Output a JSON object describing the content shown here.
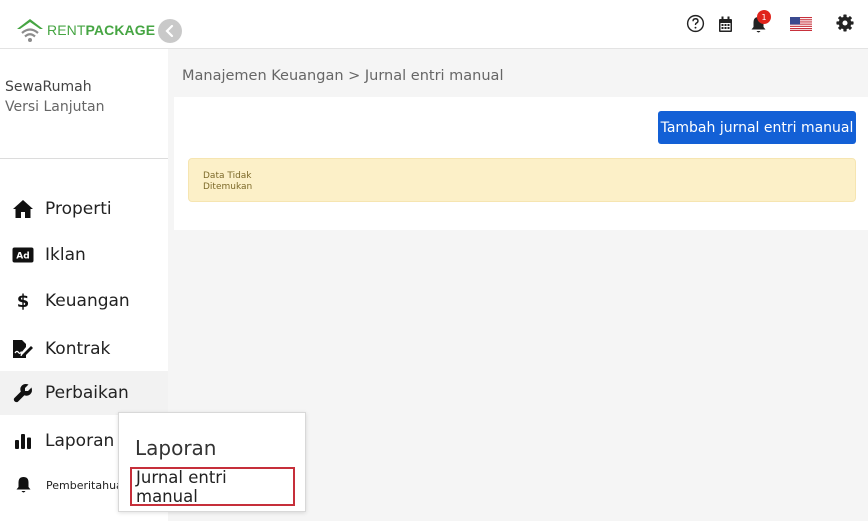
{
  "header": {
    "logo_rent": "RENT",
    "logo_package": "PACKAGE",
    "notification_count": "1",
    "icons": [
      "help-circle-icon",
      "calendar-icon",
      "bell-icon",
      "us-flag-icon",
      "gear-icon"
    ]
  },
  "sidebar": {
    "company_name": "SewaRumah",
    "company_version": "Versi Lanjutan",
    "items": [
      {
        "label": "Properti",
        "icon": "home-icon"
      },
      {
        "label": "Iklan",
        "icon": "ad-icon"
      },
      {
        "label": "Keuangan",
        "icon": "dollar-icon"
      },
      {
        "label": "Kontrak",
        "icon": "contract-icon"
      },
      {
        "label": "Perbaikan",
        "icon": "wrench-icon"
      },
      {
        "label": "Laporan",
        "icon": "bar-chart-icon"
      },
      {
        "label": "Pemberitahuan",
        "icon": "bell-icon"
      }
    ]
  },
  "main": {
    "breadcrumb": "Manajemen Keuangan > Jurnal entri manual",
    "add_button": "Tambah jurnal entri manual",
    "empty_message": "Data Tidak Ditemukan"
  },
  "popover": {
    "title": "Laporan",
    "item": "Jurnal entri manual"
  },
  "colors": {
    "brand_green": "#46a543",
    "primary_button": "#1360d6",
    "alert_background": "#fcf0c8",
    "highlight_border": "#c62f3a",
    "badge": "#e0241c"
  }
}
